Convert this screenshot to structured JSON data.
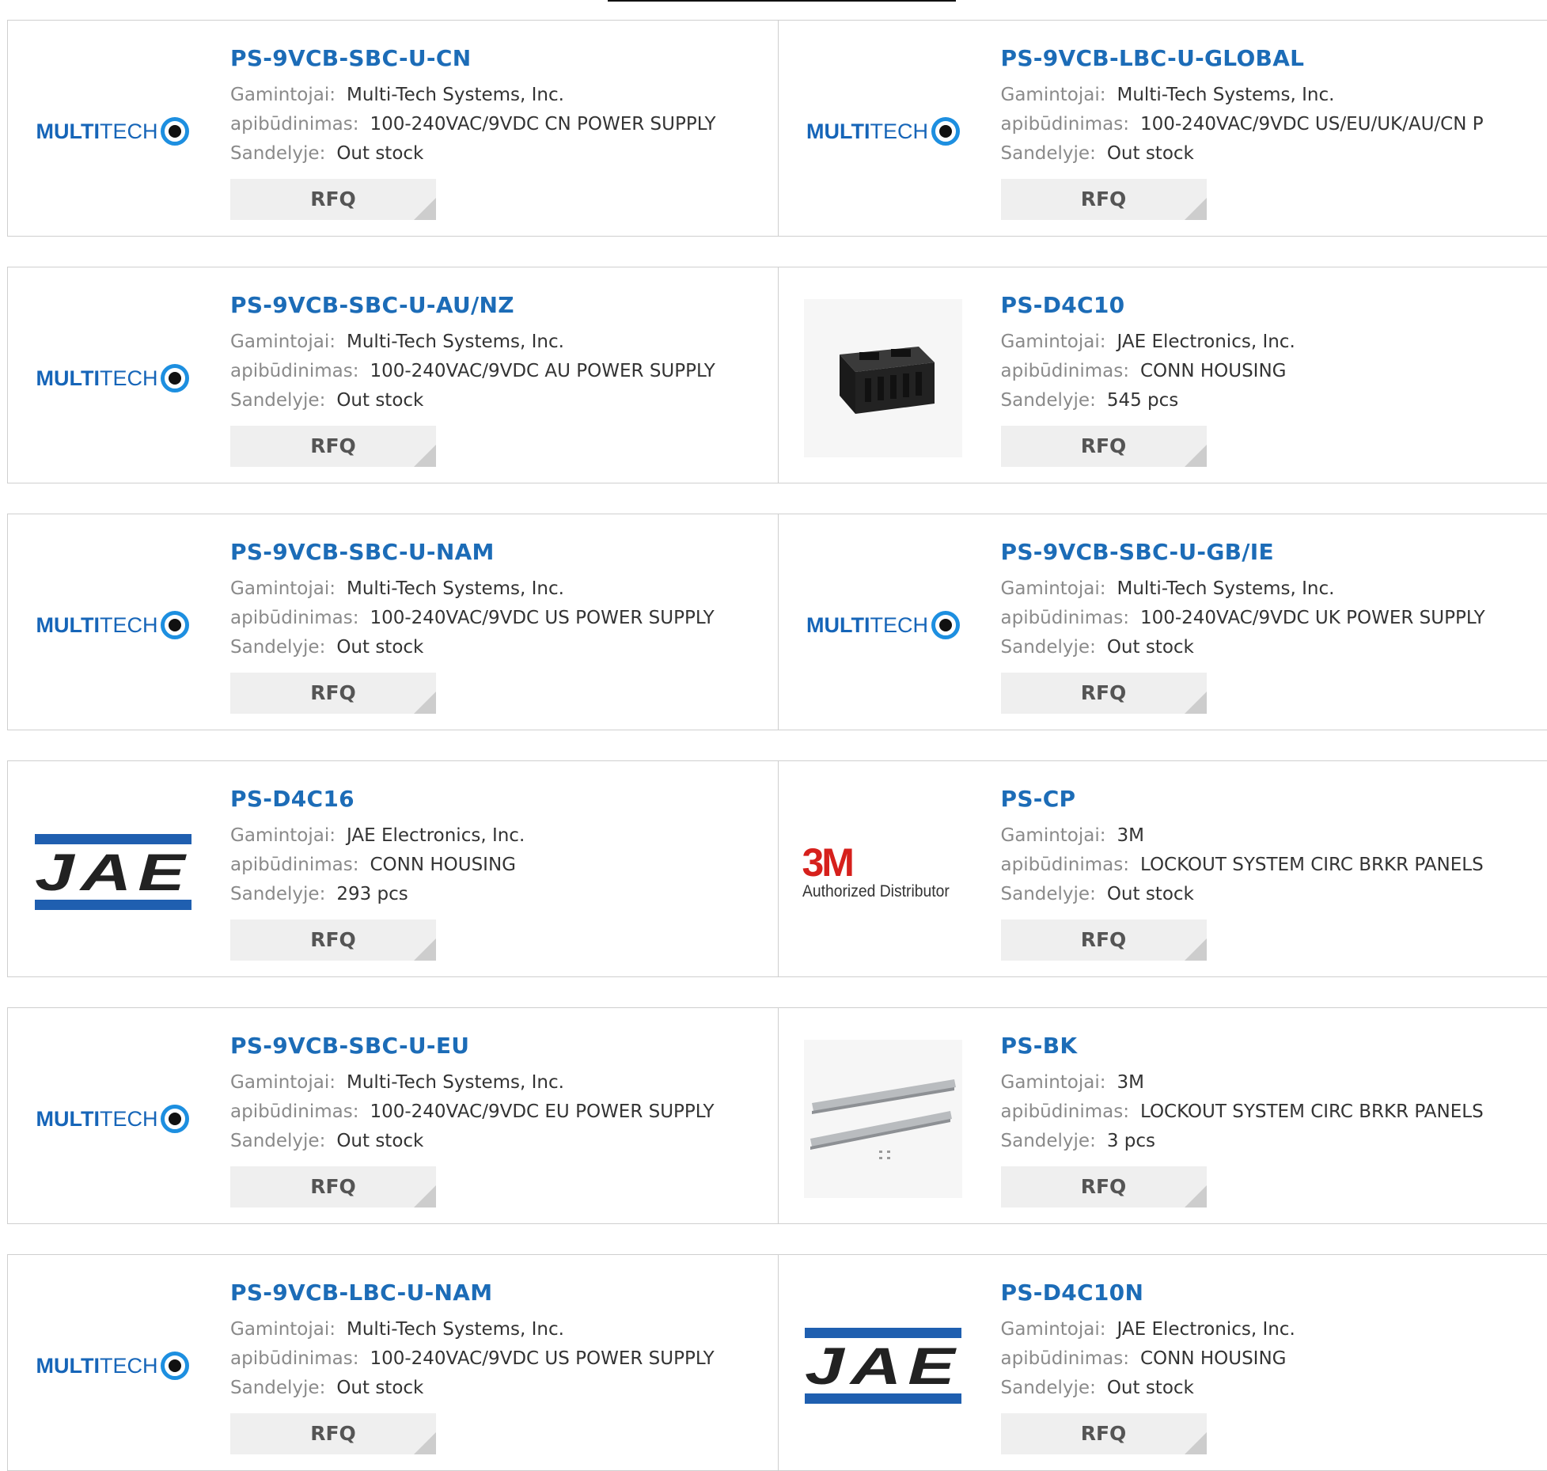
{
  "labels": {
    "manufacturer": "Gamintojai:",
    "description": "apibūdinimas:",
    "stock": "Sandelyje:",
    "rfq": "RFQ"
  },
  "products": [
    {
      "name": "PS-9VCB-SBC-U-CN",
      "manufacturer": "Multi-Tech Systems, Inc.",
      "description": "100-240VAC/9VDC CN POWER SUPPLY",
      "stock": "Out stock",
      "logo": "multitech-logo"
    },
    {
      "name": "PS-9VCB-LBC-U-GLOBAL",
      "manufacturer": "Multi-Tech Systems, Inc.",
      "description": "100-240VAC/9VDC US/EU/UK/AU/CN P",
      "stock": "Out stock",
      "logo": "multitech-logo"
    },
    {
      "name": "PS-9VCB-SBC-U-AU/NZ",
      "manufacturer": "Multi-Tech Systems, Inc.",
      "description": "100-240VAC/9VDC AU POWER SUPPLY",
      "stock": "Out stock",
      "logo": "multitech-logo"
    },
    {
      "name": "PS-D4C10",
      "manufacturer": "JAE Electronics, Inc.",
      "description": "CONN HOUSING",
      "stock": "545 pcs",
      "logo": "connector-housing-photo"
    },
    {
      "name": "PS-9VCB-SBC-U-NAM",
      "manufacturer": "Multi-Tech Systems, Inc.",
      "description": "100-240VAC/9VDC US POWER SUPPLY",
      "stock": "Out stock",
      "logo": "multitech-logo"
    },
    {
      "name": "PS-9VCB-SBC-U-GB/IE",
      "manufacturer": "Multi-Tech Systems, Inc.",
      "description": "100-240VAC/9VDC UK POWER SUPPLY",
      "stock": "Out stock",
      "logo": "multitech-logo"
    },
    {
      "name": "PS-D4C16",
      "manufacturer": "JAE Electronics, Inc.",
      "description": "CONN HOUSING",
      "stock": "293 pcs",
      "logo": "jae-logo"
    },
    {
      "name": "PS-CP",
      "manufacturer": "3M",
      "description": "LOCKOUT SYSTEM CIRC BRKR PANELS",
      "stock": "Out stock",
      "logo": "3m-logo"
    },
    {
      "name": "PS-9VCB-SBC-U-EU",
      "manufacturer": "Multi-Tech Systems, Inc.",
      "description": "100-240VAC/9VDC EU POWER SUPPLY",
      "stock": "Out stock",
      "logo": "multitech-logo"
    },
    {
      "name": "PS-BK",
      "manufacturer": "3M",
      "description": "LOCKOUT SYSTEM CIRC BRKR PANELS",
      "stock": "3 pcs",
      "logo": "rail-bracket-photo"
    },
    {
      "name": "PS-9VCB-LBC-U-NAM",
      "manufacturer": "Multi-Tech Systems, Inc.",
      "description": "100-240VAC/9VDC US POWER SUPPLY",
      "stock": "Out stock",
      "logo": "multitech-logo"
    },
    {
      "name": "PS-D4C10N",
      "manufacturer": "JAE Electronics, Inc.",
      "description": "CONN HOUSING",
      "stock": "Out stock",
      "logo": "jae-logo"
    }
  ],
  "logos": {
    "multitech": {
      "part1": "MULTI",
      "part2": "TECH"
    },
    "jae": {
      "text": "JAE"
    },
    "m3": {
      "big": "3M",
      "sub": "Authorized Distributor"
    }
  },
  "colors": {
    "link": "#1c6cb7",
    "label": "#8a8a8a",
    "button_bg": "#efefef",
    "border": "#cfcfcf"
  }
}
